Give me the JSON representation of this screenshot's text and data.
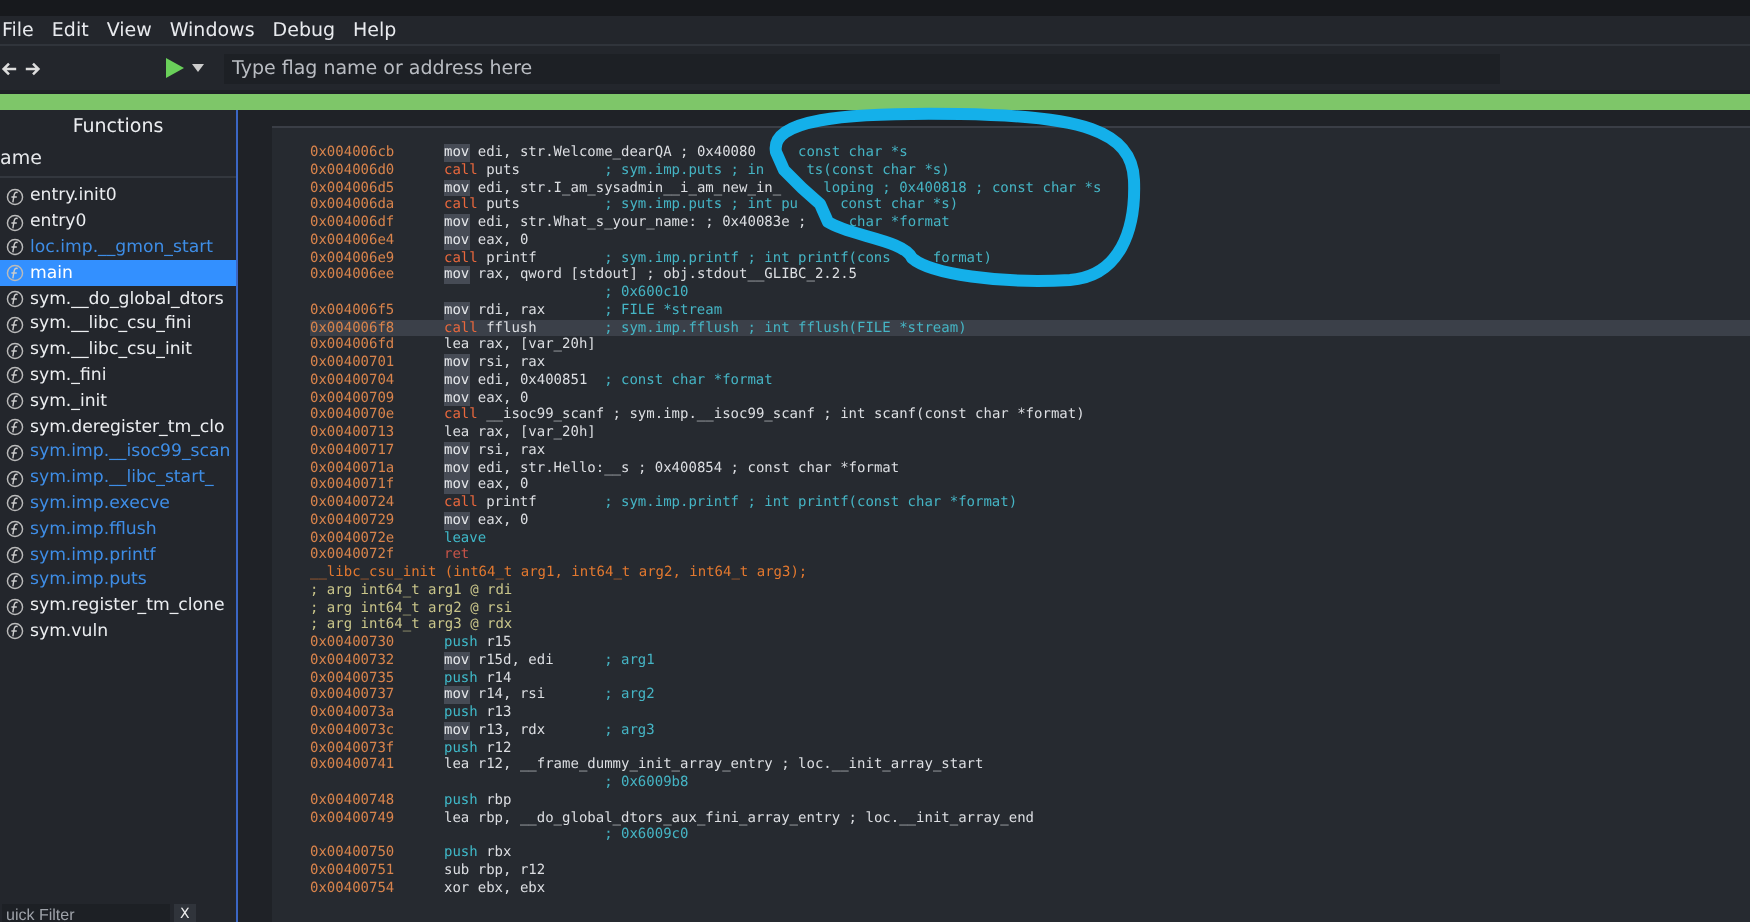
{
  "menu": [
    "File",
    "Edit",
    "View",
    "Windows",
    "Debug",
    "Help"
  ],
  "toolbar": {
    "search": {
      "placeholder": "Type flag name or address here"
    }
  },
  "sidebar": {
    "title": "Functions",
    "column": "ame",
    "filter": {
      "placeholder": "uick Filter"
    },
    "close": "X",
    "items": [
      {
        "label": "entry.init0",
        "imported": false,
        "selected": false
      },
      {
        "label": "entry0",
        "imported": false,
        "selected": false
      },
      {
        "label": "loc.imp.__gmon_start",
        "imported": true,
        "selected": false
      },
      {
        "label": "main",
        "imported": false,
        "selected": true
      },
      {
        "label": "sym.__do_global_dtors",
        "imported": false,
        "selected": false
      },
      {
        "label": "sym.__libc_csu_fini",
        "imported": false,
        "selected": false
      },
      {
        "label": "sym.__libc_csu_init",
        "imported": false,
        "selected": false
      },
      {
        "label": "sym._fini",
        "imported": false,
        "selected": false
      },
      {
        "label": "sym._init",
        "imported": false,
        "selected": false
      },
      {
        "label": "sym.deregister_tm_clo",
        "imported": false,
        "selected": false
      },
      {
        "label": "sym.imp.__isoc99_scan",
        "imported": true,
        "selected": false
      },
      {
        "label": "sym.imp.__libc_start_",
        "imported": true,
        "selected": false
      },
      {
        "label": "sym.imp.execve",
        "imported": true,
        "selected": false
      },
      {
        "label": "sym.imp.fflush",
        "imported": true,
        "selected": false
      },
      {
        "label": "sym.imp.printf",
        "imported": true,
        "selected": false
      },
      {
        "label": "sym.imp.puts",
        "imported": true,
        "selected": false
      },
      {
        "label": "sym.register_tm_clone",
        "imported": false,
        "selected": false
      },
      {
        "label": "sym.vuln",
        "imported": false,
        "selected": false
      }
    ]
  },
  "disassembly": {
    "lines": [
      {
        "kind": "move",
        "addr": "0x004006cb",
        "op": "mov",
        "args": "edi, str.Welcome_dearQA ; 0x40080",
        "after_gap": "const char *s",
        "selected": false
      },
      {
        "kind": "branch",
        "addr": "0x004006d0",
        "op": "call",
        "args": "puts",
        "comment": "; sym.imp.puts ; in",
        "after_gap": "ts(const char *s)",
        "selected": false
      },
      {
        "kind": "move",
        "addr": "0x004006d5",
        "op": "mov",
        "args": "edi, str.I_am_sysadmin__i_am_new_in_",
        "after_gap": "loping ; 0x400818 ; const char *s",
        "selected": false
      },
      {
        "kind": "branch",
        "addr": "0x004006da",
        "op": "call",
        "args": "puts",
        "comment": "; sym.imp.puts ; int pu",
        "after_gap": "const char *s)",
        "selected": false
      },
      {
        "kind": "move",
        "addr": "0x004006df",
        "op": "mov",
        "args": "edi, str.What_s_your_name: ; 0x40083e ;",
        "after_gap": "char *format",
        "selected": false
      },
      {
        "kind": "move",
        "addr": "0x004006e4",
        "op": "mov",
        "args": "eax, 0",
        "selected": false
      },
      {
        "kind": "branch",
        "addr": "0x004006e9",
        "op": "call",
        "args": "printf",
        "comment": "; sym.imp.printf ; int printf(cons",
        "after_gap": "format)",
        "selected": false
      },
      {
        "kind": "move",
        "addr": "0x004006ee",
        "op": "mov",
        "args": "rax, qword [stdout] ; obj.stdout__GLIBC_2.2.5",
        "selected": false
      },
      {
        "kind": "continuation",
        "comment": "; 0x600c10",
        "selected": false
      },
      {
        "kind": "move",
        "addr": "0x004006f5",
        "op": "mov",
        "args": "rdi, rax",
        "comment": "; FILE *stream",
        "selected": false
      },
      {
        "kind": "branch",
        "addr": "0x004006f8",
        "op": "call",
        "args": "fflush",
        "comment": "; sym.imp.fflush ; int fflush(FILE *stream)",
        "selected": true
      },
      {
        "kind": "other",
        "addr": "0x004006fd",
        "op": "lea",
        "args": "rax, [var_20h]",
        "selected": false
      },
      {
        "kind": "move",
        "addr": "0x00400701",
        "op": "mov",
        "args": "rsi, rax",
        "selected": false
      },
      {
        "kind": "move",
        "addr": "0x00400704",
        "op": "mov",
        "args": "edi, 0x400851",
        "comment": "; const char *format",
        "selected": false
      },
      {
        "kind": "move",
        "addr": "0x00400709",
        "op": "mov",
        "args": "eax, 0",
        "selected": false
      },
      {
        "kind": "branch",
        "addr": "0x0040070e",
        "op": "call",
        "args": "__isoc99_scanf ; sym.imp.__isoc99_scanf ; int scanf(const char *format)",
        "selected": false
      },
      {
        "kind": "other",
        "addr": "0x00400713",
        "op": "lea",
        "args": "rax, [var_20h]",
        "selected": false
      },
      {
        "kind": "move",
        "addr": "0x00400717",
        "op": "mov",
        "args": "rsi, rax",
        "selected": false
      },
      {
        "kind": "move",
        "addr": "0x0040071a",
        "op": "mov",
        "args": "edi, str.Hello:__s ; 0x400854 ; const char *format",
        "selected": false
      },
      {
        "kind": "move",
        "addr": "0x0040071f",
        "op": "mov",
        "args": "eax, 0",
        "selected": false
      },
      {
        "kind": "branch",
        "addr": "0x00400724",
        "op": "call",
        "args": "printf",
        "comment": "; sym.imp.printf ; int printf(const char *format)",
        "selected": false
      },
      {
        "kind": "move",
        "addr": "0x00400729",
        "op": "mov",
        "args": "eax, 0",
        "selected": false
      },
      {
        "kind": "stack",
        "addr": "0x0040072e",
        "op": "leave",
        "selected": false
      },
      {
        "kind": "return",
        "addr": "0x0040072f",
        "op": "ret",
        "selected": false
      },
      {
        "kind": "header",
        "text": "__libc_csu_init (int64_t arg1, int64_t arg2, int64_t arg3);",
        "selected": false
      },
      {
        "kind": "argument",
        "text": "; arg int64_t arg1 @ rdi",
        "selected": false
      },
      {
        "kind": "argument",
        "text": "; arg int64_t arg2 @ rsi",
        "selected": false
      },
      {
        "kind": "argument",
        "text": "; arg int64_t arg3 @ rdx",
        "selected": false
      },
      {
        "kind": "stack",
        "addr": "0x00400730",
        "op": "push",
        "args": "r15",
        "selected": false
      },
      {
        "kind": "move",
        "addr": "0x00400732",
        "op": "mov",
        "args": "r15d, edi",
        "comment": "; arg1",
        "selected": false
      },
      {
        "kind": "stack",
        "addr": "0x00400735",
        "op": "push",
        "args": "r14",
        "selected": false
      },
      {
        "kind": "move",
        "addr": "0x00400737",
        "op": "mov",
        "args": "r14, rsi",
        "comment": "; arg2",
        "selected": false
      },
      {
        "kind": "stack",
        "addr": "0x0040073a",
        "op": "push",
        "args": "r13",
        "selected": false
      },
      {
        "kind": "move",
        "addr": "0x0040073c",
        "op": "mov",
        "args": "r13, rdx",
        "comment": "; arg3",
        "selected": false
      },
      {
        "kind": "stack",
        "addr": "0x0040073f",
        "op": "push",
        "args": "r12",
        "selected": false
      },
      {
        "kind": "other",
        "addr": "0x00400741",
        "op": "lea",
        "args": "r12, __frame_dummy_init_array_entry ; loc.__init_array_start",
        "selected": false
      },
      {
        "kind": "continuation",
        "comment": "; 0x6009b8",
        "selected": false
      },
      {
        "kind": "stack",
        "addr": "0x00400748",
        "op": "push",
        "args": "rbp",
        "selected": false
      },
      {
        "kind": "other",
        "addr": "0x00400749",
        "op": "lea",
        "args": "rbp, __do_global_dtors_aux_fini_array_entry ; loc.__init_array_end",
        "selected": false
      },
      {
        "kind": "continuation",
        "comment": "; 0x6009c0",
        "selected": false
      },
      {
        "kind": "stack",
        "addr": "0x00400750",
        "op": "push",
        "args": "rbx",
        "selected": false
      },
      {
        "kind": "other",
        "addr": "0x00400751",
        "op": "sub",
        "args": "rbp, r12",
        "selected": false
      },
      {
        "kind": "other",
        "addr": "0x00400754",
        "op": "xor",
        "args": "ebx, ebx",
        "selected": false
      }
    ]
  }
}
